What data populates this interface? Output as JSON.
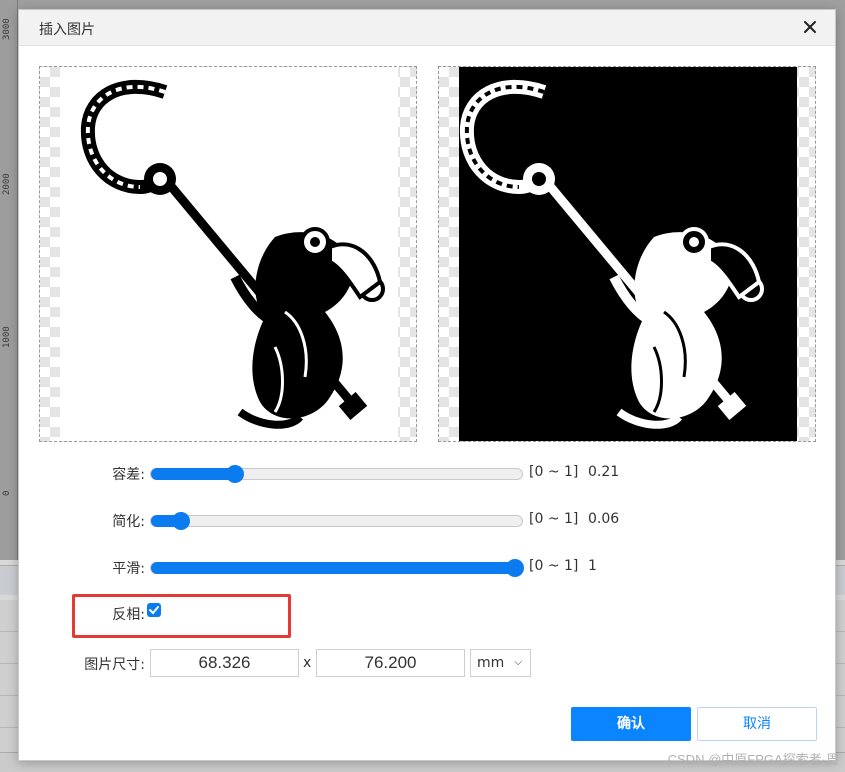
{
  "background": {
    "ruler_ticks": [
      "3000",
      "2000",
      "1000",
      "0"
    ]
  },
  "dialog": {
    "title": "插入图片",
    "close_icon": "close-icon"
  },
  "sliders": [
    {
      "label": "容差:",
      "range": "[0 ~ 1]",
      "value": "0.21",
      "fraction": 0.21
    },
    {
      "label": "简化:",
      "range": "[0 ~ 1]",
      "value": "0.06",
      "fraction": 0.06
    },
    {
      "label": "平滑:",
      "range": "[0 ~ 1]",
      "value": "1",
      "fraction": 1
    }
  ],
  "invert": {
    "label": "反相:",
    "checked": true
  },
  "size": {
    "label": "图片尺寸:",
    "width": "68.326",
    "separator": "x",
    "height": "76.200",
    "unit": "mm"
  },
  "buttons": {
    "ok": "确认",
    "cancel": "取消"
  },
  "watermark": "CSDN @中原FPGA探索者·周",
  "colors": {
    "accent": "#0a84ff",
    "highlight": "#e53935"
  }
}
